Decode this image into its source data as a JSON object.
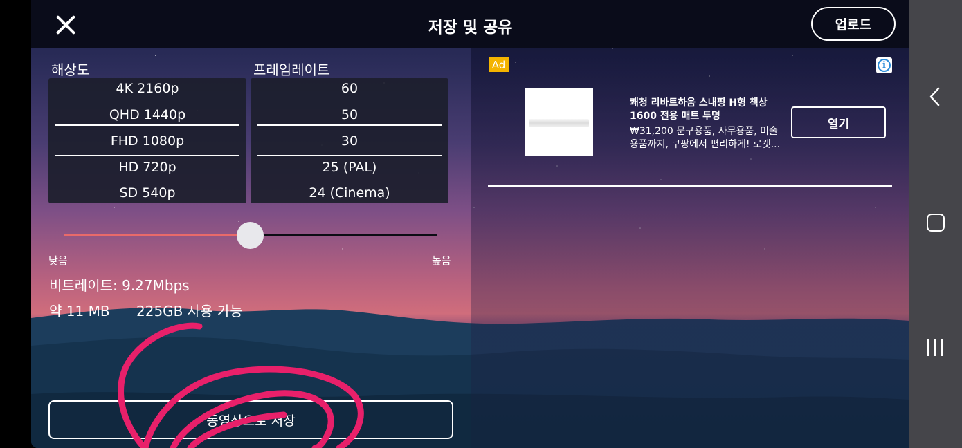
{
  "header": {
    "title": "저장 및 공유",
    "upload_label": "업로드"
  },
  "resolution": {
    "label": "해상도",
    "options": [
      "4K 2160p",
      "QHD 1440p",
      "FHD 1080p",
      "HD 720p",
      "SD 540p"
    ],
    "selected": "FHD 1080p"
  },
  "framerate": {
    "label": "프레임레이트",
    "options": [
      "60",
      "50",
      "30",
      "25 (PAL)",
      "24 (Cinema)"
    ],
    "selected": "30"
  },
  "quality_slider": {
    "low_label": "낮음",
    "high_label": "높음",
    "value_fraction": 0.5
  },
  "bitrate_text": "비트레이트: 9.27Mbps",
  "file_size_text": "약 11 MB",
  "storage_text": "225GB 사용 가능",
  "save_button_label": "동영상으로 저장",
  "ad": {
    "badge": "Ad",
    "title": "쾌청 리바트하움 스내핑 H형 책상 1600 전용 매트 투명",
    "description": "₩31,200 문구용품, 사무용품, 미술용품까지, 쿠팡에서 편리하게! 로켓...",
    "open_label": "열기"
  },
  "colors": {
    "accent_slider": "#e96a6a",
    "scribble": "#e8206a",
    "ad_badge": "#f4b400",
    "nav_bar": "#45454a"
  }
}
